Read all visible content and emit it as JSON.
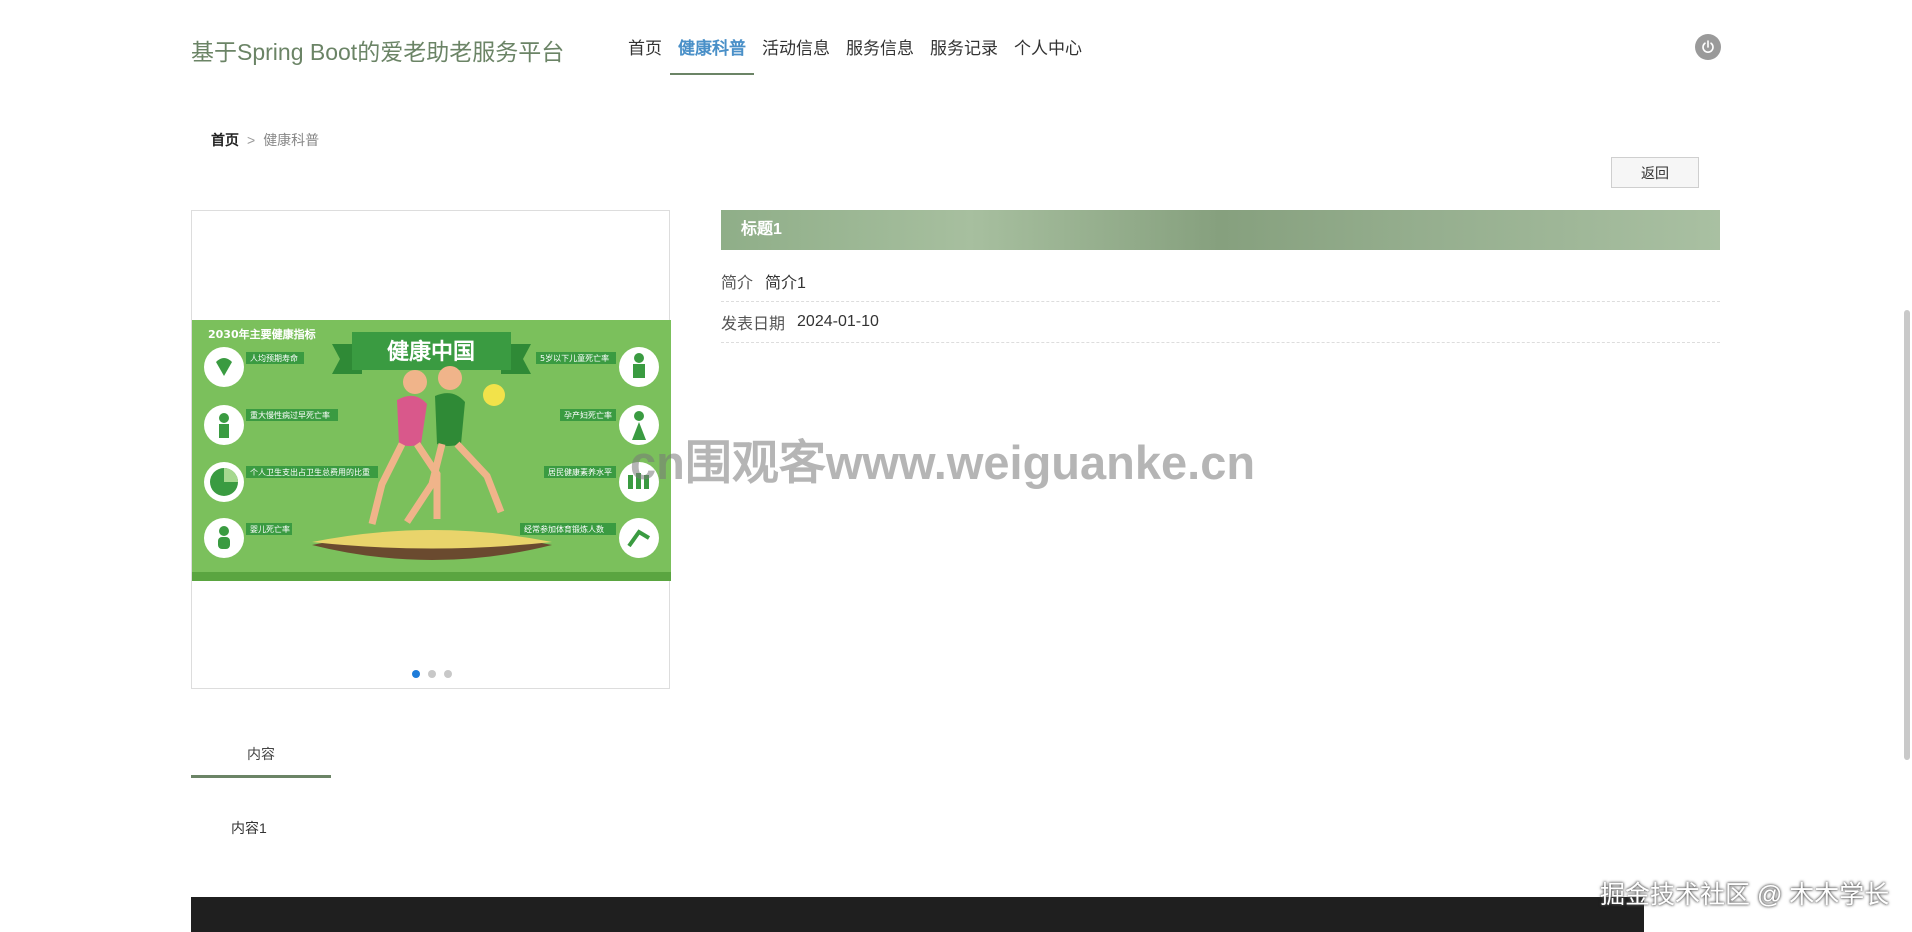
{
  "header": {
    "site_title": "基于Spring Boot的爱老助老服务平台",
    "nav": [
      {
        "label": "首页"
      },
      {
        "label": "健康科普"
      },
      {
        "label": "活动信息"
      },
      {
        "label": "服务信息"
      },
      {
        "label": "服务记录"
      },
      {
        "label": "个人中心"
      }
    ],
    "active_nav_index": 1,
    "power_icon": "power-icon"
  },
  "breadcrumb": {
    "home": "首页",
    "separator": ">",
    "current": "健康科普"
  },
  "actions": {
    "back_label": "返回"
  },
  "carousel": {
    "slide_count": 3,
    "active_index": 0,
    "poster": {
      "heading": "2030年主要健康指标",
      "banner": "健康中国",
      "left_items": [
        "人均预期寿命",
        "重大慢性病过早死亡率",
        "个人卫生支出占卫生总费用的比重",
        "婴儿死亡率"
      ],
      "right_items": [
        "5岁以下儿童死亡率",
        "孕产妇死亡率",
        "居民健康素养水平",
        "经常参加体育锻炼人数"
      ]
    }
  },
  "detail": {
    "title": "标题1",
    "fields": [
      {
        "label": "简介",
        "value": "简介1"
      },
      {
        "label": "发表日期",
        "value": "2024-01-10"
      }
    ]
  },
  "tabs": [
    {
      "label": "内容"
    }
  ],
  "content": {
    "text": "内容1"
  },
  "overlays": {
    "watermark": "cn围观客www.weiguanke.cn",
    "corner_mark": "掘金技术社区 @ 木木学长"
  },
  "colors": {
    "accent_green": "#6b8466",
    "active_nav_blue": "#4a90c8",
    "footer": "#1f1f1f"
  }
}
